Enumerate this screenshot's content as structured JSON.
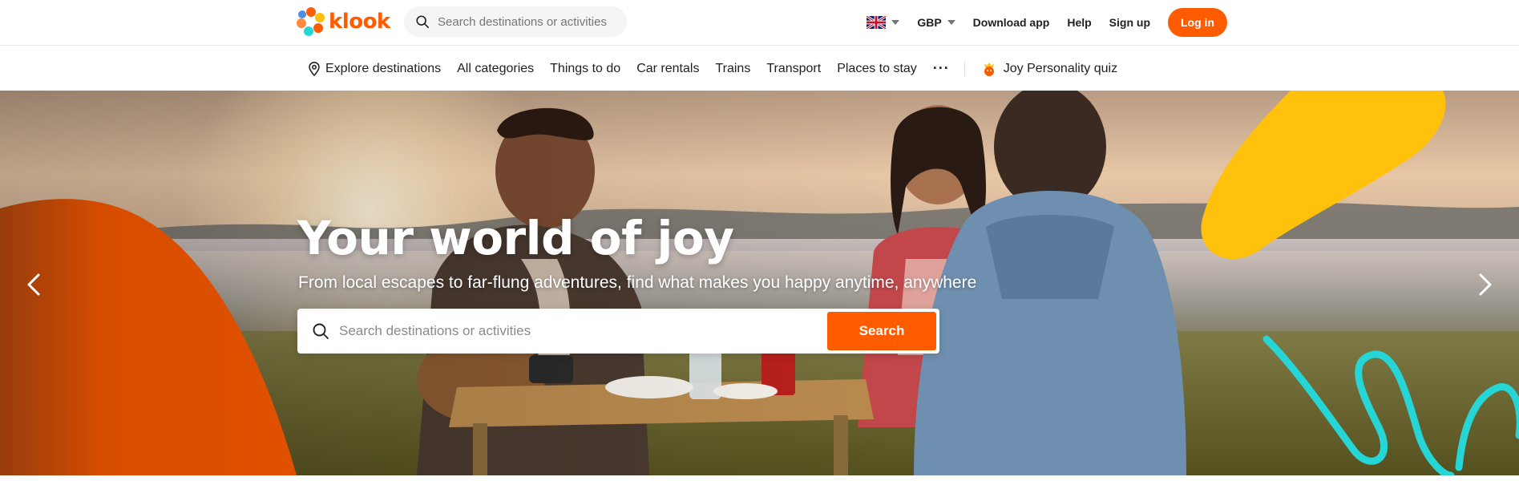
{
  "brand": {
    "name": "klook",
    "accent": "#ff5b00"
  },
  "header": {
    "search_placeholder": "Search destinations or activities",
    "language_icon": "uk-flag-icon",
    "currency": "GBP",
    "download_app": "Download app",
    "help": "Help",
    "sign_up": "Sign up",
    "log_in": "Log in"
  },
  "nav": {
    "explore": "Explore destinations",
    "items": [
      "All categories",
      "Things to do",
      "Car rentals",
      "Trains",
      "Transport",
      "Places to stay"
    ],
    "more": "···",
    "quiz": "Joy Personality quiz"
  },
  "hero": {
    "title": "Your world of joy",
    "subtitle": "From local escapes to far-flung adventures, find what makes you happy anytime, anywhere",
    "search_placeholder": "Search destinations or activities",
    "search_button": "Search",
    "prev_icon": "chevron-left-icon",
    "next_icon": "chevron-right-icon"
  },
  "colors": {
    "orange": "#ff5b00",
    "yellow": "#ffc10b",
    "teal": "#26d5d5"
  }
}
